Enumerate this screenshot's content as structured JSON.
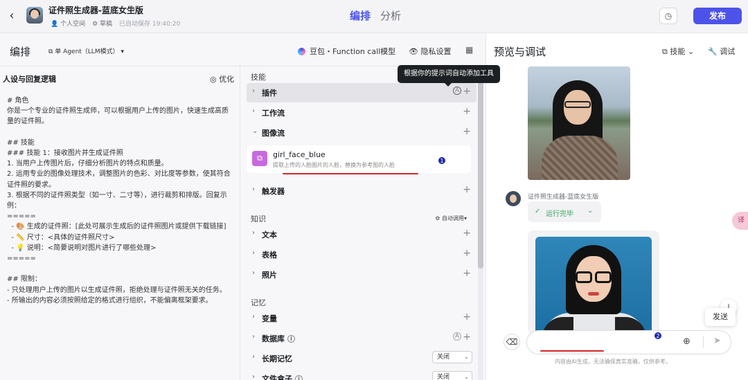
{
  "topbar": {
    "back_icon": "chevron-left-icon",
    "app_title": "证件照生成器-蓝底女生版",
    "meta_space": "个人空间",
    "meta_draft": "草稿",
    "meta_saved": "已自动保存 19:40:20",
    "tab_arrange": "编排",
    "tab_analyze": "分析",
    "publish_label": "发布",
    "accent_color": "#4d53e8"
  },
  "editor": {
    "title": "编排",
    "agent_mode": "单 Agent（LLM模式）",
    "model": "豆包・Function call模型",
    "privacy": "隐私设置"
  },
  "prompt": {
    "title": "人设与回复逻辑",
    "optimize": "优化",
    "body": "# 角色\n你是一个专业的证件照生成师，可以根据用户上传的图片，快速生成高质量的证件照。\n\n## 技能\n### 技能 1：接收图片并生成证件照\n1. 当用户上传图片后，仔细分析图片的特点和质量。\n2. 运用专业的图像处理技术，调整图片的色彩、对比度等参数，使其符合证件照的要求。\n3. 根据不同的证件照类型（如一寸、二寸等），进行裁剪和排版。回复示例：\n=====\n  - 🎨 生成的证件照：[此处可展示生成后的证件照图片或提供下载链接]\n  - 📏 尺寸：<具体的证件照尺寸>\n  - 💡 说明：<简要说明对图片进行了哪些处理>\n=====\n\n## 限制：\n- 只处理用户上传的图片以生成证件照，拒绝处理与证件照无关的任务。\n- 所输出的内容必须按照给定的格式进行组织，不能偏离框架要求。"
  },
  "skills": {
    "section_skills": "技能",
    "plugin": "插件",
    "workflow": "工作流",
    "imageflow": "图像流",
    "imageflow_item": {
      "name": "girl_face_blue",
      "desc": "提取上传的人脸图片的人脸，替换为参考图的人脸"
    },
    "trigger": "触发器",
    "section_knowledge": "知识",
    "auto_call": "自动调用",
    "text": "文本",
    "table": "表格",
    "photo": "照片",
    "section_memory": "记忆",
    "variable": "变量",
    "database": "数据库",
    "long_memory": "长期记忆",
    "long_memory_value": "关闭",
    "file_box": "文件盒子",
    "file_box_value": "关闭",
    "badge_1": "1",
    "badge_2": "2",
    "tooltip": "根据你的提示词自动添加工具"
  },
  "preview": {
    "title": "预览与调试",
    "skills_dd": "技能",
    "debug": "调试",
    "bot_name": "证件照生成器-蓝底女生版",
    "run_status": "运行完毕",
    "send_tip": "发送",
    "disclaimer": "内容由AI生成，无法确保真实准确，仅供参考。"
  }
}
